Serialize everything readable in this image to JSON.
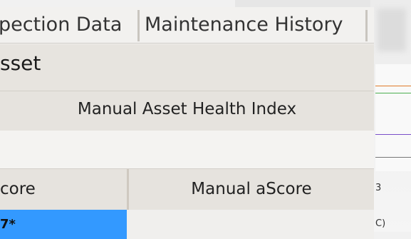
{
  "tabs": [
    {
      "label": "pection Data"
    },
    {
      "label": "Maintenance History"
    }
  ],
  "asset": {
    "title": "sset"
  },
  "health_index": {
    "label": "Manual Asset Health Index"
  },
  "table": {
    "headers": [
      "core",
      "Manual aScore"
    ],
    "rows": [
      [
        "7*",
        ""
      ]
    ]
  },
  "background": {
    "partial_labels": [
      "3",
      "C)"
    ]
  },
  "colors": {
    "selection": "#3399ff"
  }
}
